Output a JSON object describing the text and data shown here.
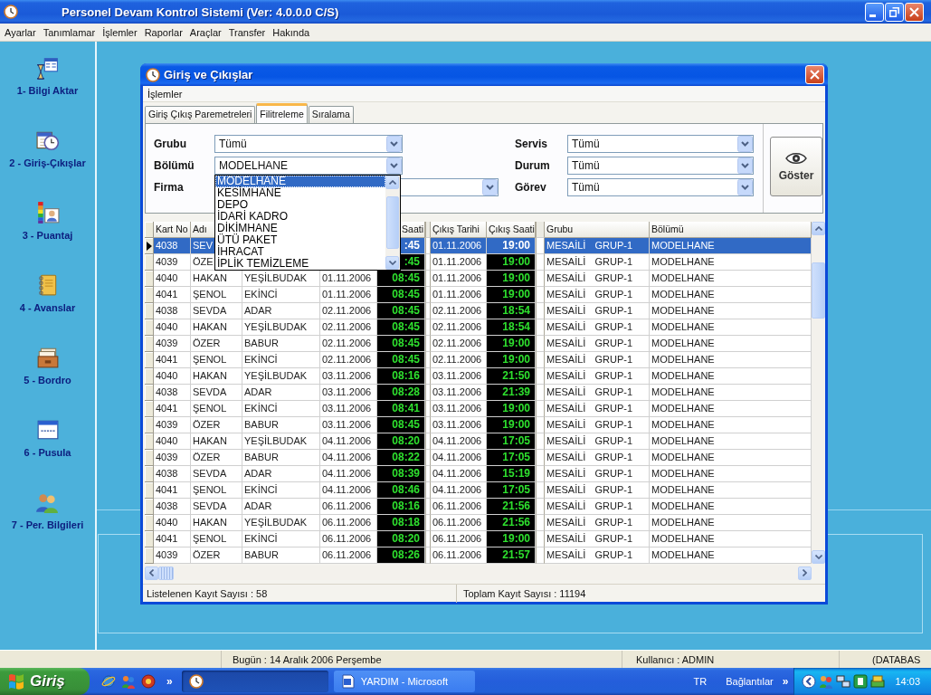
{
  "window": {
    "title": "Personel Devam Kontrol Sistemi (Ver: 4.0.0.0 C/S)"
  },
  "menu": [
    "Ayarlar",
    "Tanımlamar",
    "İşlemler",
    "Raporlar",
    "Araçlar",
    "Transfer",
    "Hakında"
  ],
  "sidebar": {
    "items": [
      {
        "label": "1- Bilgi Aktar"
      },
      {
        "label": "2 - Giriş-Çıkışlar"
      },
      {
        "label": "3 - Puantaj"
      },
      {
        "label": "4 - Avanslar"
      },
      {
        "label": "5 - Bordro"
      },
      {
        "label": "6 - Pusula"
      },
      {
        "label": "7 - Per. Bilgileri"
      }
    ]
  },
  "dialog": {
    "title": "Giriş ve Çıkışlar",
    "menu": [
      "İşlemler"
    ],
    "tabs": [
      {
        "label": "Giriş Çıkış Paremetreleri",
        "selected": false
      },
      {
        "label": "Filitreleme",
        "selected": true
      },
      {
        "label": "Sıralama",
        "selected": false
      }
    ],
    "filters_left": [
      {
        "label": "Grubu",
        "value": "Tümü",
        "expanded": false
      },
      {
        "label": "Bölümü",
        "value": "MODELHANE",
        "expanded": true,
        "options": [
          {
            "label": "MODELHANE",
            "selected": true
          },
          {
            "label": "KESİMHANE",
            "selected": false
          },
          {
            "label": "DEPO",
            "selected": false
          },
          {
            "label": "İDARİ KADRO",
            "selected": false
          },
          {
            "label": "DİKİMHANE",
            "selected": false
          },
          {
            "label": "ÜTÜ PAKET",
            "selected": false
          },
          {
            "label": "İHRACAT",
            "selected": false
          },
          {
            "label": "İPLİK TEMİZLEME",
            "selected": false
          }
        ]
      },
      {
        "label": "Firma",
        "expanded": false
      }
    ],
    "filters_right": [
      {
        "label": "Servis",
        "value": "Tümü",
        "expanded": false
      },
      {
        "label": "Durum",
        "value": "Tümü",
        "expanded": false
      },
      {
        "label": "Görev",
        "value": "Tümü",
        "expanded": false
      }
    ],
    "show_button": "Göster",
    "table": {
      "columns": [
        "Kart No",
        "Adı",
        null,
        null,
        "Saati",
        "Çıkış Tarihi",
        "Çıkış Saati",
        "Grubu",
        "Bölümü"
      ],
      "rows": [
        {
          "selected": true,
          "cells": [
            "4038",
            "SEV",
            null,
            null,
            ":45",
            "01.11.2006",
            "19:00",
            "MESAİLİ GRUP-1",
            "MODELHANE"
          ]
        },
        {
          "selected": false,
          "cells": [
            "4039",
            "ÖZE",
            null,
            null,
            ":45",
            "01.11.2006",
            "19:00",
            "MESAİLİ GRUP-1",
            "MODELHANE"
          ]
        },
        {
          "selected": false,
          "cells": [
            "4040",
            "HAKAN",
            "YEŞİLBUDAK",
            "01.11.2006",
            "08:45",
            "01.11.2006",
            "19:00",
            "MESAİLİ GRUP-1",
            "MODELHANE"
          ]
        },
        {
          "selected": false,
          "cells": [
            "4041",
            "ŞENOL",
            "EKİNCİ",
            "01.11.2006",
            "08:45",
            "01.11.2006",
            "19:00",
            "MESAİLİ GRUP-1",
            "MODELHANE"
          ]
        },
        {
          "selected": false,
          "cells": [
            "4038",
            "SEVDA",
            "ADAR",
            "02.11.2006",
            "08:45",
            "02.11.2006",
            "18:54",
            "MESAİLİ GRUP-1",
            "MODELHANE"
          ]
        },
        {
          "selected": false,
          "cells": [
            "4040",
            "HAKAN",
            "YEŞİLBUDAK",
            "02.11.2006",
            "08:45",
            "02.11.2006",
            "18:54",
            "MESAİLİ GRUP-1",
            "MODELHANE"
          ]
        },
        {
          "selected": false,
          "cells": [
            "4039",
            "ÖZER",
            "BABUR",
            "02.11.2006",
            "08:45",
            "02.11.2006",
            "19:00",
            "MESAİLİ GRUP-1",
            "MODELHANE"
          ]
        },
        {
          "selected": false,
          "cells": [
            "4041",
            "ŞENOL",
            "EKİNCİ",
            "02.11.2006",
            "08:45",
            "02.11.2006",
            "19:00",
            "MESAİLİ GRUP-1",
            "MODELHANE"
          ]
        },
        {
          "selected": false,
          "cells": [
            "4040",
            "HAKAN",
            "YEŞİLBUDAK",
            "03.11.2006",
            "08:16",
            "03.11.2006",
            "21:50",
            "MESAİLİ GRUP-1",
            "MODELHANE"
          ]
        },
        {
          "selected": false,
          "cells": [
            "4038",
            "SEVDA",
            "ADAR",
            "03.11.2006",
            "08:28",
            "03.11.2006",
            "21:39",
            "MESAİLİ GRUP-1",
            "MODELHANE"
          ]
        },
        {
          "selected": false,
          "cells": [
            "4041",
            "ŞENOL",
            "EKİNCİ",
            "03.11.2006",
            "08:41",
            "03.11.2006",
            "19:00",
            "MESAİLİ GRUP-1",
            "MODELHANE"
          ]
        },
        {
          "selected": false,
          "cells": [
            "4039",
            "ÖZER",
            "BABUR",
            "03.11.2006",
            "08:45",
            "03.11.2006",
            "19:00",
            "MESAİLİ GRUP-1",
            "MODELHANE"
          ]
        },
        {
          "selected": false,
          "cells": [
            "4040",
            "HAKAN",
            "YEŞİLBUDAK",
            "04.11.2006",
            "08:20",
            "04.11.2006",
            "17:05",
            "MESAİLİ GRUP-1",
            "MODELHANE"
          ]
        },
        {
          "selected": false,
          "cells": [
            "4039",
            "ÖZER",
            "BABUR",
            "04.11.2006",
            "08:22",
            "04.11.2006",
            "17:05",
            "MESAİLİ GRUP-1",
            "MODELHANE"
          ]
        },
        {
          "selected": false,
          "cells": [
            "4038",
            "SEVDA",
            "ADAR",
            "04.11.2006",
            "08:39",
            "04.11.2006",
            "15:19",
            "MESAİLİ GRUP-1",
            "MODELHANE"
          ]
        },
        {
          "selected": false,
          "cells": [
            "4041",
            "ŞENOL",
            "EKİNCİ",
            "04.11.2006",
            "08:46",
            "04.11.2006",
            "17:05",
            "MESAİLİ GRUP-1",
            "MODELHANE"
          ]
        },
        {
          "selected": false,
          "cells": [
            "4038",
            "SEVDA",
            "ADAR",
            "06.11.2006",
            "08:16",
            "06.11.2006",
            "21:56",
            "MESAİLİ GRUP-1",
            "MODELHANE"
          ]
        },
        {
          "selected": false,
          "cells": [
            "4040",
            "HAKAN",
            "YEŞİLBUDAK",
            "06.11.2006",
            "08:18",
            "06.11.2006",
            "21:56",
            "MESAİLİ GRUP-1",
            "MODELHANE"
          ]
        },
        {
          "selected": false,
          "cells": [
            "4041",
            "ŞENOL",
            "EKİNCİ",
            "06.11.2006",
            "08:20",
            "06.11.2006",
            "19:00",
            "MESAİLİ GRUP-1",
            "MODELHANE"
          ]
        },
        {
          "selected": false,
          "cells": [
            "4039",
            "ÖZER",
            "BABUR",
            "06.11.2006",
            "08:26",
            "06.11.2006",
            "21:57",
            "MESAİLİ GRUP-1",
            "MODELHANE"
          ]
        }
      ]
    },
    "status": [
      "Listelenen Kayıt Sayısı : 58",
      "Toplam Kayıt Sayısı : 11194"
    ]
  },
  "status_bar": [
    "Bugün : 14 Aralık 2006 Perşembe",
    "Kullanıcı : ADMIN",
    "(DATABAS"
  ],
  "taskbar": {
    "start": "Giriş",
    "quick_launch_more": "»",
    "tasks": [
      {
        "selected": true
      },
      {
        "label": "YARDIM - Microsoft",
        "selected": false
      }
    ],
    "language": "TR",
    "toolbar": "Bağlantılar",
    "toolbar_more": "»",
    "time": "14:03"
  }
}
